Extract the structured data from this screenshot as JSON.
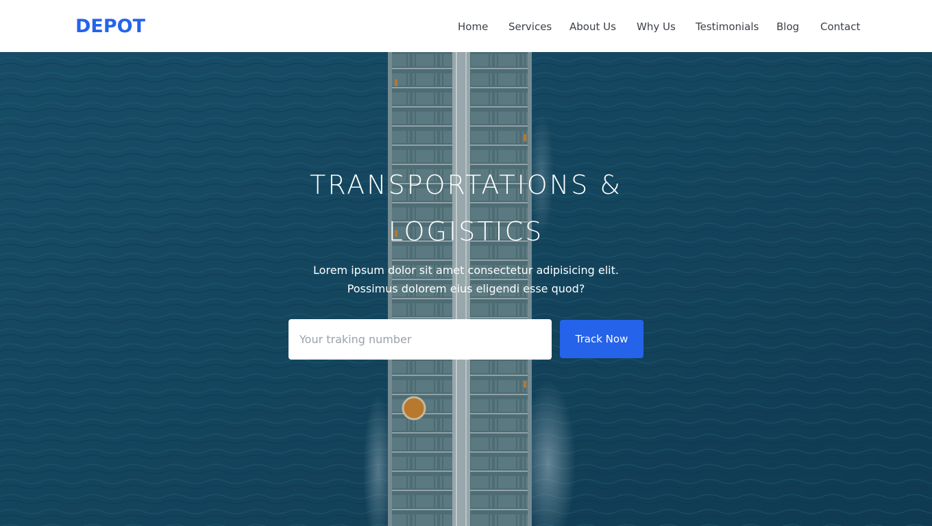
{
  "brand": {
    "logo_text": "DEPOT",
    "accent_color": "#2563eb"
  },
  "nav": {
    "items": [
      {
        "label": "Home"
      },
      {
        "label": "Services"
      },
      {
        "label": "About Us"
      },
      {
        "label": "Why Us"
      },
      {
        "label": "Testimonials"
      },
      {
        "label": "Blog"
      },
      {
        "label": "Contact"
      }
    ]
  },
  "hero": {
    "title_line1": "TRANSPORTATIONS &",
    "title_line2": "LOGISTICS",
    "subtitle_line1": "Lorem ipsum dolor sit amet consectetur adipisicing elit.",
    "subtitle_line2": "Possimus dolorem eius eligendi esse quod?",
    "background_image": "aerial-view-of-cargo-tanker-ship-on-ocean"
  },
  "tracking": {
    "placeholder": "Your traking number",
    "value": "",
    "button_label": "Track Now"
  }
}
